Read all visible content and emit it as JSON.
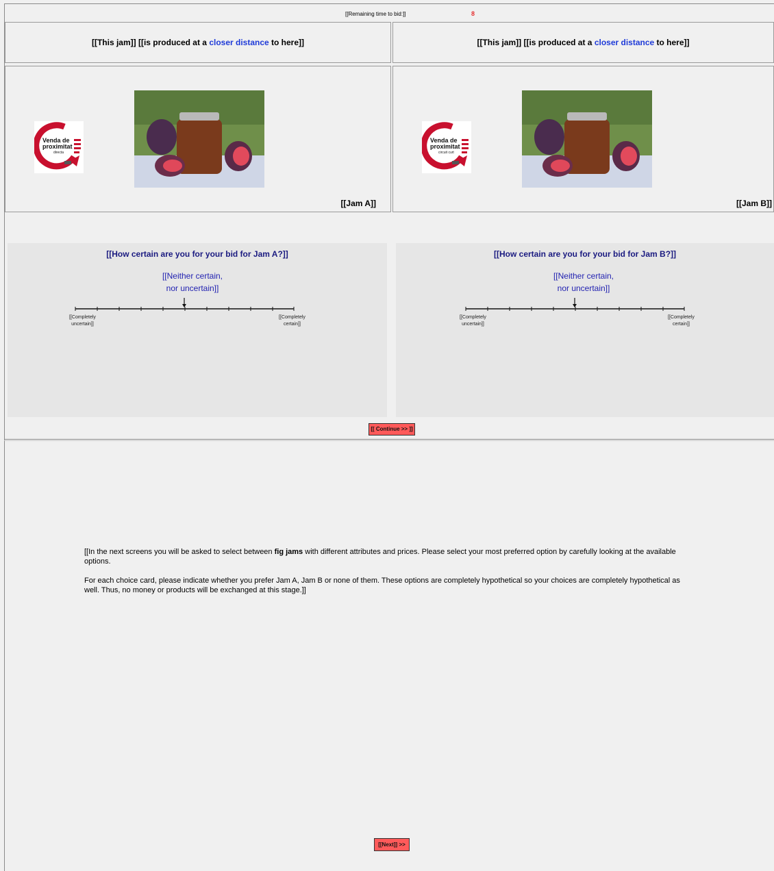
{
  "timer": {
    "label": "[[Remaining time to bid:]]",
    "value": "8"
  },
  "products": [
    {
      "header_pre": "[[This jam]] [[is  produced at a ",
      "header_highlight": "closer distance",
      "header_post": " to here]]",
      "logo_line1": "Venda de",
      "logo_line2": "proximitat",
      "logo_line3": "directa",
      "label": "[[Jam A]]",
      "question": "[[How certain are you for your bid for Jam A?]]",
      "neutral_line1": "[[Neither certain,",
      "neutral_line2": "nor uncertain]]",
      "left_end_1": "[[Completely",
      "left_end_2": "uncertain]]",
      "right_end_1": "[[Completely",
      "right_end_2": "certain]]"
    },
    {
      "header_pre": "[[This jam]] [[is produced at a ",
      "header_highlight": "closer distance",
      "header_post": " to here]]",
      "logo_line1": "Venda de",
      "logo_line2": "proximitat",
      "logo_line3": "circuit curt",
      "label": "[[Jam B]]",
      "question": "[[How certain are you for your bid for Jam B?]]",
      "neutral_line1": "[[Neither certain,",
      "neutral_line2": "nor uncertain]]",
      "left_end_1": "[[Completely",
      "left_end_2": "uncertain]]",
      "right_end_1": "[[Completely",
      "right_end_2": "certain]]"
    }
  ],
  "continue_label": "[[ Continue >> ]]",
  "instructions": {
    "p1_pre": "[[In the next screens you will be asked to select between ",
    "p1_bold": "fig jams",
    "p1_post": " with different attributes and prices. Please select your most preferred option by carefully looking at the available options.",
    "p2": "For each choice card, please indicate whether you prefer Jam A, Jam B or none of them. These options are completely hypothetical so your choices are completely hypothetical as well. Thus, no money or products will be exchanged at this stage.]]"
  },
  "next_label": "[[Next]] >>",
  "colors": {
    "accent_blue": "#1f3bd8",
    "button_red": "#ff5a5a",
    "timer_red": "#e53030",
    "logo_red": "#c8102e"
  }
}
